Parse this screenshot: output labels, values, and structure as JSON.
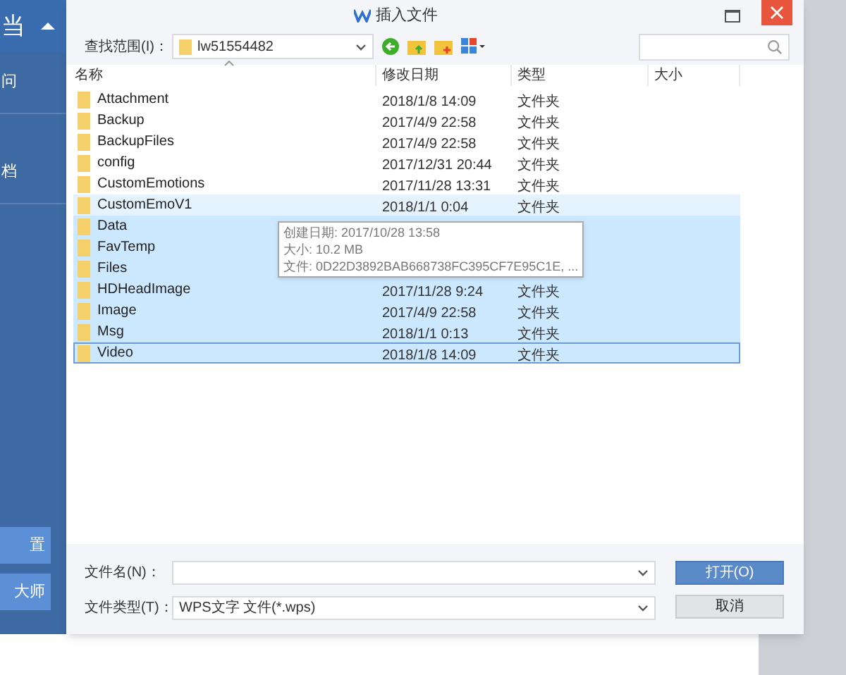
{
  "background_app": {
    "title": "当",
    "items": [
      "问",
      "档"
    ],
    "buttons": [
      "置",
      "大师"
    ]
  },
  "dialog": {
    "title": "插入文件",
    "toolbar": {
      "look_in_label": "查找范围(I)：",
      "look_in_value": "lw51554482"
    },
    "columns": [
      "名称",
      "修改日期",
      "类型",
      "大小"
    ],
    "rows": [
      {
        "name": "Attachment",
        "date": "2018/1/8 14:09",
        "type": "文件夹",
        "selected": false,
        "hovered": false,
        "focused": false
      },
      {
        "name": "Backup",
        "date": "2017/4/9 22:58",
        "type": "文件夹",
        "selected": false,
        "hovered": false,
        "focused": false
      },
      {
        "name": "BackupFiles",
        "date": "2017/4/9 22:58",
        "type": "文件夹",
        "selected": false,
        "hovered": false,
        "focused": false
      },
      {
        "name": "config",
        "date": "2017/12/31 20:44",
        "type": "文件夹",
        "selected": false,
        "hovered": false,
        "focused": false
      },
      {
        "name": "CustomEmotions",
        "date": "2017/11/28 13:31",
        "type": "文件夹",
        "selected": false,
        "hovered": false,
        "focused": false
      },
      {
        "name": "CustomEmoV1",
        "date": "2018/1/1 0:04",
        "type": "文件夹",
        "selected": false,
        "hovered": true,
        "focused": false
      },
      {
        "name": "Data",
        "selected": true,
        "hovered": false,
        "focused": false
      },
      {
        "name": "FavTemp",
        "selected": true,
        "hovered": false,
        "focused": false
      },
      {
        "name": "Files",
        "selected": true,
        "hovered": false,
        "focused": false
      },
      {
        "name": "HDHeadImage",
        "date": "2017/11/28 9:24",
        "type": "文件夹",
        "selected": true,
        "hovered": false,
        "focused": false
      },
      {
        "name": "Image",
        "date": "2017/4/9 22:58",
        "type": "文件夹",
        "selected": true,
        "hovered": false,
        "focused": false
      },
      {
        "name": "Msg",
        "date": "2018/1/1 0:13",
        "type": "文件夹",
        "selected": true,
        "hovered": false,
        "focused": false
      },
      {
        "name": "Video",
        "date": "2018/1/8 14:09",
        "type": "文件夹",
        "selected": true,
        "hovered": false,
        "focused": true
      }
    ],
    "tooltip": [
      "创建日期: 2017/10/28 13:58",
      "大小: 10.2 MB",
      "文件: 0D22D3892BAB668738FC395CF7E95C1E, ..."
    ],
    "filename": {
      "label": "文件名(N)："
    },
    "filetype": {
      "label": "文件类型(T)：",
      "value": "WPS文字 文件(*.wps)"
    },
    "buttons": [
      {
        "label": "打开(O)",
        "primary": true
      },
      {
        "label": "取消",
        "primary": false
      }
    ]
  }
}
